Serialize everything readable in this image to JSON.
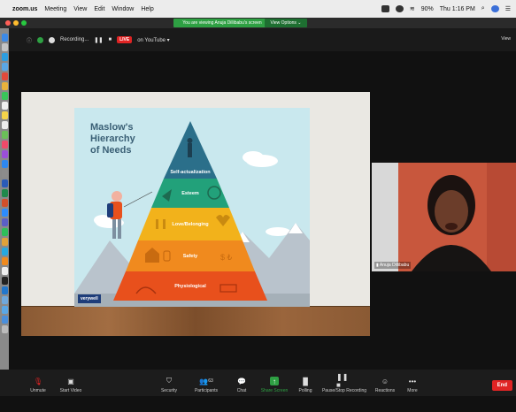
{
  "menubar": {
    "app_name": "zoom.us",
    "items": [
      "Meeting",
      "View",
      "Edit",
      "Window",
      "Help"
    ],
    "battery": "90%",
    "clock": "Thu 1:16 PM"
  },
  "zoombar": {
    "viewing_banner": "You are viewing Anuja Dillibabu's screen",
    "view_options": "View Options ⌄"
  },
  "recbar": {
    "recording_label": "Recording...",
    "live_badge": "LIVE",
    "live_target": "on YouTube ▾",
    "view_button": "View"
  },
  "slide": {
    "title_line1": "Maslow's",
    "title_line2": "Hierarchy",
    "title_line3": "of Needs",
    "tiers": [
      "Self-actualization",
      "Esteem",
      "Love/Belonging",
      "Safety",
      "Physiological"
    ],
    "brand": "verywell"
  },
  "participant": {
    "name": "Anuja Dillibabu"
  },
  "controls": {
    "unmute": "Unmute",
    "start_video": "Start Video",
    "security": "Security",
    "participants": "Participants",
    "participants_count": "63",
    "chat": "Chat",
    "share_screen": "Share Screen",
    "polling": "Polling",
    "pause_recording": "Pause/Stop Recording",
    "reactions": "Reactions",
    "more": "More",
    "end": "End"
  },
  "colors": {
    "zoom_green": "#2ea043",
    "live_red": "#e02424",
    "tier1": "#2b6f8a",
    "tier2": "#22a17a",
    "tier3": "#f2b21b",
    "tier4": "#f08a1e",
    "tier5": "#e8501c"
  }
}
